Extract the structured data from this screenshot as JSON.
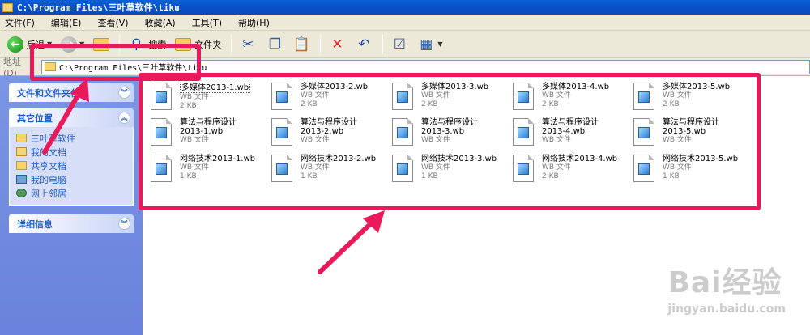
{
  "window": {
    "title": "C:\\Program Files\\三叶草软件\\tiku"
  },
  "menu": [
    "文件(F)",
    "编辑(E)",
    "查看(V)",
    "收藏(A)",
    "工具(T)",
    "帮助(H)"
  ],
  "toolbar": {
    "back_label": "后退",
    "search_label": "搜索",
    "folders_label": "文件夹"
  },
  "address": {
    "label": "地址(D)",
    "value": "C:\\Program Files\\三叶草软件\\tiku"
  },
  "left": {
    "tasks_title": "文件和文件夹任务",
    "places_title": "其它位置",
    "places": [
      {
        "label": "三叶草软件",
        "icon": "folder-icon"
      },
      {
        "label": "我的文档",
        "icon": "my-documents-icon"
      },
      {
        "label": "共享文档",
        "icon": "shared-documents-icon"
      },
      {
        "label": "我的电脑",
        "icon": "my-computer-icon"
      },
      {
        "label": "网上邻居",
        "icon": "network-icon"
      }
    ],
    "details_title": "详细信息"
  },
  "files": [
    {
      "name": "多媒体2013-1.wb",
      "type": "WB 文件",
      "size": "2 KB"
    },
    {
      "name": "多媒体2013-2.wb",
      "type": "WB 文件",
      "size": "2 KB"
    },
    {
      "name": "多媒体2013-3.wb",
      "type": "WB 文件",
      "size": "2 KB"
    },
    {
      "name": "多媒体2013-4.wb",
      "type": "WB 文件",
      "size": "2 KB"
    },
    {
      "name": "多媒体2013-5.wb",
      "type": "WB 文件",
      "size": "2 KB"
    },
    {
      "name": "算法与程序设计",
      "name2": "2013-1.wb",
      "type": "WB 文件"
    },
    {
      "name": "算法与程序设计",
      "name2": "2013-2.wb",
      "type": "WB 文件"
    },
    {
      "name": "算法与程序设计",
      "name2": "2013-3.wb",
      "type": "WB 文件"
    },
    {
      "name": "算法与程序设计",
      "name2": "2013-4.wb",
      "type": "WB 文件"
    },
    {
      "name": "算法与程序设计",
      "name2": "2013-5.wb",
      "type": "WB 文件"
    },
    {
      "name": "网络技术2013-1.wb",
      "type": "WB 文件",
      "size": "1 KB"
    },
    {
      "name": "网络技术2013-2.wb",
      "type": "WB 文件",
      "size": "1 KB"
    },
    {
      "name": "网络技术2013-3.wb",
      "type": "WB 文件",
      "size": "1 KB"
    },
    {
      "name": "网络技术2013-4.wb",
      "type": "WB 文件",
      "size": "2 KB"
    },
    {
      "name": "网络技术2013-5.wb",
      "type": "WB 文件",
      "size": "1 KB"
    }
  ],
  "watermark": {
    "brand": "Bai经验",
    "url": "jingyan.baidu.com"
  },
  "colors": {
    "annotation": "#ea1a5a",
    "titlebar": "#0a4fc4",
    "taskpane": "#7a96e3"
  }
}
